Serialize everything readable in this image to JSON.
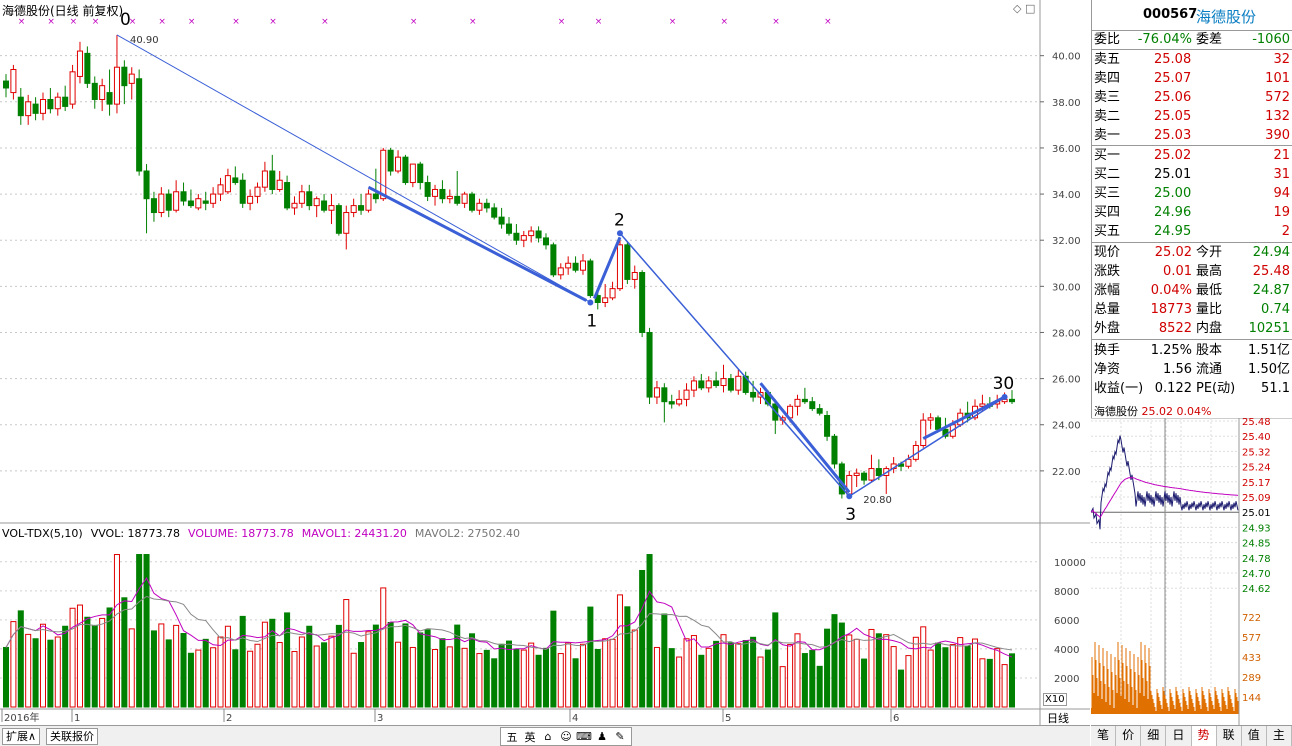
{
  "stock": {
    "code": "000567",
    "name": "海德股份"
  },
  "chart_header": {
    "title": "海德股份(日线 前复权)"
  },
  "price_axis": {
    "labels": [
      "40.00",
      "38.00",
      "36.00",
      "34.00",
      "32.00",
      "30.00",
      "28.00",
      "26.00",
      "24.00",
      "22.00"
    ]
  },
  "time_axis": {
    "labels": [
      "2016年",
      "1",
      "2",
      "3",
      "4",
      "5",
      "6"
    ]
  },
  "annotations": {
    "labels": [
      "0",
      "1",
      "2",
      "3",
      "30"
    ],
    "high_label": "40.90",
    "low_label": "20.80"
  },
  "candles": [
    {
      "o": 38.9,
      "h": 39.2,
      "l": 38.2,
      "c": 38.6
    },
    {
      "o": 38.4,
      "h": 39.6,
      "l": 38.1,
      "c": 39.4
    },
    {
      "o": 38.2,
      "h": 38.6,
      "l": 37.0,
      "c": 37.4
    },
    {
      "o": 37.4,
      "h": 38.3,
      "l": 37.0,
      "c": 38.0
    },
    {
      "o": 37.9,
      "h": 38.2,
      "l": 37.2,
      "c": 37.5
    },
    {
      "o": 37.5,
      "h": 38.4,
      "l": 37.2,
      "c": 38.1
    },
    {
      "o": 38.1,
      "h": 38.6,
      "l": 37.5,
      "c": 37.7
    },
    {
      "o": 37.7,
      "h": 38.4,
      "l": 37.4,
      "c": 38.2
    },
    {
      "o": 38.2,
      "h": 38.7,
      "l": 37.6,
      "c": 37.8
    },
    {
      "o": 37.9,
      "h": 39.6,
      "l": 37.7,
      "c": 39.3
    },
    {
      "o": 39.1,
      "h": 40.6,
      "l": 38.8,
      "c": 40.2
    },
    {
      "o": 40.1,
      "h": 40.4,
      "l": 38.6,
      "c": 38.8
    },
    {
      "o": 38.8,
      "h": 39.1,
      "l": 37.7,
      "c": 38.1
    },
    {
      "o": 38.1,
      "h": 39.0,
      "l": 37.6,
      "c": 38.7
    },
    {
      "o": 38.4,
      "h": 39.4,
      "l": 37.4,
      "c": 37.9
    },
    {
      "o": 37.9,
      "h": 40.9,
      "l": 37.5,
      "c": 39.5
    },
    {
      "o": 39.5,
      "h": 39.8,
      "l": 37.9,
      "c": 38.7
    },
    {
      "o": 38.8,
      "h": 39.5,
      "l": 38.1,
      "c": 39.2
    },
    {
      "o": 39.0,
      "h": 39.4,
      "l": 34.8,
      "c": 35.0
    },
    {
      "o": 35.0,
      "h": 35.3,
      "l": 32.3,
      "c": 33.8
    },
    {
      "o": 33.8,
      "h": 34.1,
      "l": 32.8,
      "c": 33.2
    },
    {
      "o": 33.2,
      "h": 34.3,
      "l": 33.0,
      "c": 34.0
    },
    {
      "o": 34.0,
      "h": 34.2,
      "l": 33.0,
      "c": 33.3
    },
    {
      "o": 33.3,
      "h": 34.6,
      "l": 33.2,
      "c": 34.1
    },
    {
      "o": 34.1,
      "h": 34.5,
      "l": 33.5,
      "c": 33.7
    },
    {
      "o": 33.7,
      "h": 34.2,
      "l": 33.4,
      "c": 33.5
    },
    {
      "o": 33.4,
      "h": 34.0,
      "l": 33.3,
      "c": 33.8
    },
    {
      "o": 33.7,
      "h": 34.1,
      "l": 33.3,
      "c": 33.6
    },
    {
      "o": 33.6,
      "h": 34.3,
      "l": 33.4,
      "c": 34.0
    },
    {
      "o": 34.0,
      "h": 34.7,
      "l": 33.7,
      "c": 34.4
    },
    {
      "o": 34.1,
      "h": 35.1,
      "l": 34.0,
      "c": 34.8
    },
    {
      "o": 34.7,
      "h": 35.2,
      "l": 34.4,
      "c": 34.5
    },
    {
      "o": 34.6,
      "h": 34.9,
      "l": 33.4,
      "c": 33.6
    },
    {
      "o": 33.6,
      "h": 34.2,
      "l": 33.3,
      "c": 33.9
    },
    {
      "o": 33.9,
      "h": 34.5,
      "l": 33.6,
      "c": 34.3
    },
    {
      "o": 34.3,
      "h": 35.4,
      "l": 34.1,
      "c": 35.0
    },
    {
      "o": 35.0,
      "h": 35.7,
      "l": 34.0,
      "c": 34.2
    },
    {
      "o": 34.2,
      "h": 35.0,
      "l": 34.1,
      "c": 34.6
    },
    {
      "o": 34.5,
      "h": 34.8,
      "l": 33.3,
      "c": 33.4
    },
    {
      "o": 33.4,
      "h": 33.9,
      "l": 33.1,
      "c": 33.6
    },
    {
      "o": 33.6,
      "h": 34.4,
      "l": 33.4,
      "c": 34.1
    },
    {
      "o": 34.1,
      "h": 34.4,
      "l": 33.3,
      "c": 33.5
    },
    {
      "o": 33.5,
      "h": 33.9,
      "l": 33.0,
      "c": 33.8
    },
    {
      "o": 33.7,
      "h": 34.0,
      "l": 33.2,
      "c": 33.3
    },
    {
      "o": 33.3,
      "h": 34.0,
      "l": 32.7,
      "c": 33.5
    },
    {
      "o": 33.5,
      "h": 33.6,
      "l": 32.2,
      "c": 32.3
    },
    {
      "o": 32.3,
      "h": 33.5,
      "l": 31.6,
      "c": 33.2
    },
    {
      "o": 33.2,
      "h": 33.8,
      "l": 33.0,
      "c": 33.5
    },
    {
      "o": 33.5,
      "h": 34.0,
      "l": 33.1,
      "c": 33.3
    },
    {
      "o": 33.3,
      "h": 34.2,
      "l": 33.2,
      "c": 34.0
    },
    {
      "o": 34.0,
      "h": 35.1,
      "l": 33.6,
      "c": 33.8
    },
    {
      "o": 33.8,
      "h": 36.0,
      "l": 33.7,
      "c": 35.9
    },
    {
      "o": 35.9,
      "h": 36.0,
      "l": 34.8,
      "c": 35.0
    },
    {
      "o": 35.0,
      "h": 35.9,
      "l": 34.9,
      "c": 35.6
    },
    {
      "o": 35.6,
      "h": 35.7,
      "l": 34.4,
      "c": 34.5
    },
    {
      "o": 34.5,
      "h": 35.3,
      "l": 34.3,
      "c": 35.3
    },
    {
      "o": 35.3,
      "h": 35.4,
      "l": 34.2,
      "c": 34.5
    },
    {
      "o": 34.5,
      "h": 34.8,
      "l": 33.7,
      "c": 33.9
    },
    {
      "o": 33.9,
      "h": 34.4,
      "l": 33.5,
      "c": 34.2
    },
    {
      "o": 34.2,
      "h": 34.6,
      "l": 33.6,
      "c": 33.8
    },
    {
      "o": 33.8,
      "h": 34.2,
      "l": 33.6,
      "c": 33.9
    },
    {
      "o": 33.9,
      "h": 35.0,
      "l": 33.5,
      "c": 33.6
    },
    {
      "o": 33.6,
      "h": 34.1,
      "l": 33.4,
      "c": 34.0
    },
    {
      "o": 34.0,
      "h": 34.1,
      "l": 33.2,
      "c": 33.3
    },
    {
      "o": 33.3,
      "h": 33.8,
      "l": 33.1,
      "c": 33.6
    },
    {
      "o": 33.6,
      "h": 33.8,
      "l": 33.2,
      "c": 33.4
    },
    {
      "o": 33.4,
      "h": 33.6,
      "l": 32.9,
      "c": 33.0
    },
    {
      "o": 33.0,
      "h": 33.4,
      "l": 32.5,
      "c": 32.7
    },
    {
      "o": 32.7,
      "h": 33.0,
      "l": 32.2,
      "c": 32.3
    },
    {
      "o": 32.3,
      "h": 32.7,
      "l": 31.8,
      "c": 32.0
    },
    {
      "o": 32.0,
      "h": 32.4,
      "l": 31.7,
      "c": 32.2
    },
    {
      "o": 32.2,
      "h": 32.6,
      "l": 31.9,
      "c": 32.4
    },
    {
      "o": 32.4,
      "h": 32.6,
      "l": 31.9,
      "c": 32.1
    },
    {
      "o": 32.1,
      "h": 32.3,
      "l": 31.6,
      "c": 31.8
    },
    {
      "o": 31.8,
      "h": 31.9,
      "l": 30.4,
      "c": 30.5
    },
    {
      "o": 30.5,
      "h": 31.0,
      "l": 30.3,
      "c": 30.8
    },
    {
      "o": 30.8,
      "h": 31.3,
      "l": 30.5,
      "c": 31.0
    },
    {
      "o": 31.0,
      "h": 31.3,
      "l": 30.6,
      "c": 30.7
    },
    {
      "o": 30.7,
      "h": 31.4,
      "l": 30.5,
      "c": 31.1
    },
    {
      "o": 31.1,
      "h": 31.2,
      "l": 29.5,
      "c": 29.6
    },
    {
      "o": 29.6,
      "h": 29.9,
      "l": 29.0,
      "c": 29.3
    },
    {
      "o": 29.3,
      "h": 30.1,
      "l": 29.1,
      "c": 29.5
    },
    {
      "o": 29.5,
      "h": 30.2,
      "l": 29.4,
      "c": 29.9
    },
    {
      "o": 29.9,
      "h": 32.1,
      "l": 29.8,
      "c": 31.8
    },
    {
      "o": 31.8,
      "h": 31.9,
      "l": 30.1,
      "c": 30.3
    },
    {
      "o": 30.3,
      "h": 30.9,
      "l": 29.9,
      "c": 30.6
    },
    {
      "o": 30.6,
      "h": 30.7,
      "l": 27.8,
      "c": 28.0
    },
    {
      "o": 28.0,
      "h": 28.2,
      "l": 24.9,
      "c": 25.2
    },
    {
      "o": 25.2,
      "h": 25.9,
      "l": 24.9,
      "c": 25.6
    },
    {
      "o": 25.6,
      "h": 25.8,
      "l": 24.1,
      "c": 25.0
    },
    {
      "o": 25.0,
      "h": 25.3,
      "l": 24.7,
      "c": 24.9
    },
    {
      "o": 24.9,
      "h": 25.5,
      "l": 24.8,
      "c": 25.1
    },
    {
      "o": 25.1,
      "h": 25.8,
      "l": 24.8,
      "c": 25.5
    },
    {
      "o": 25.5,
      "h": 26.1,
      "l": 25.2,
      "c": 25.9
    },
    {
      "o": 25.9,
      "h": 26.2,
      "l": 25.5,
      "c": 25.6
    },
    {
      "o": 25.6,
      "h": 26.1,
      "l": 25.4,
      "c": 25.9
    },
    {
      "o": 25.9,
      "h": 26.3,
      "l": 25.6,
      "c": 25.7
    },
    {
      "o": 25.7,
      "h": 26.6,
      "l": 25.4,
      "c": 26.0
    },
    {
      "o": 26.0,
      "h": 26.2,
      "l": 25.4,
      "c": 25.5
    },
    {
      "o": 25.5,
      "h": 26.4,
      "l": 25.3,
      "c": 26.1
    },
    {
      "o": 26.1,
      "h": 26.3,
      "l": 25.3,
      "c": 25.4
    },
    {
      "o": 25.4,
      "h": 25.9,
      "l": 25.0,
      "c": 25.2
    },
    {
      "o": 25.2,
      "h": 25.6,
      "l": 24.9,
      "c": 25.4
    },
    {
      "o": 25.4,
      "h": 25.5,
      "l": 24.8,
      "c": 24.9
    },
    {
      "o": 24.9,
      "h": 25.1,
      "l": 23.6,
      "c": 24.2
    },
    {
      "o": 24.2,
      "h": 24.4,
      "l": 24.0,
      "c": 24.3
    },
    {
      "o": 24.3,
      "h": 24.9,
      "l": 24.1,
      "c": 24.8
    },
    {
      "o": 24.8,
      "h": 25.3,
      "l": 24.4,
      "c": 25.1
    },
    {
      "o": 25.1,
      "h": 25.6,
      "l": 24.9,
      "c": 25.0
    },
    {
      "o": 25.0,
      "h": 25.2,
      "l": 24.6,
      "c": 24.7
    },
    {
      "o": 24.7,
      "h": 24.9,
      "l": 24.4,
      "c": 24.5
    },
    {
      "o": 24.4,
      "h": 24.6,
      "l": 23.3,
      "c": 23.5
    },
    {
      "o": 23.5,
      "h": 23.6,
      "l": 22.1,
      "c": 22.3
    },
    {
      "o": 22.3,
      "h": 22.4,
      "l": 20.8,
      "c": 21.0
    },
    {
      "o": 21.0,
      "h": 22.0,
      "l": 20.9,
      "c": 21.8
    },
    {
      "o": 21.8,
      "h": 22.1,
      "l": 21.3,
      "c": 21.9
    },
    {
      "o": 21.9,
      "h": 22.0,
      "l": 21.4,
      "c": 21.6
    },
    {
      "o": 21.6,
      "h": 22.7,
      "l": 21.5,
      "c": 22.1
    },
    {
      "o": 22.1,
      "h": 22.5,
      "l": 21.6,
      "c": 21.8
    },
    {
      "o": 21.8,
      "h": 22.2,
      "l": 21.0,
      "c": 22.1
    },
    {
      "o": 22.1,
      "h": 22.6,
      "l": 21.9,
      "c": 22.3
    },
    {
      "o": 22.3,
      "h": 22.4,
      "l": 22.0,
      "c": 22.2
    },
    {
      "o": 22.2,
      "h": 22.7,
      "l": 22.1,
      "c": 22.5
    },
    {
      "o": 22.5,
      "h": 23.3,
      "l": 22.4,
      "c": 23.1
    },
    {
      "o": 23.1,
      "h": 24.5,
      "l": 23.0,
      "c": 24.2
    },
    {
      "o": 24.2,
      "h": 24.5,
      "l": 23.8,
      "c": 24.3
    },
    {
      "o": 24.3,
      "h": 24.4,
      "l": 23.7,
      "c": 23.8
    },
    {
      "o": 23.8,
      "h": 24.3,
      "l": 23.4,
      "c": 23.5
    },
    {
      "o": 23.5,
      "h": 24.2,
      "l": 23.4,
      "c": 24.0
    },
    {
      "o": 24.0,
      "h": 24.7,
      "l": 23.9,
      "c": 24.5
    },
    {
      "o": 24.5,
      "h": 25.0,
      "l": 24.1,
      "c": 24.3
    },
    {
      "o": 24.3,
      "h": 25.1,
      "l": 24.2,
      "c": 24.8
    },
    {
      "o": 24.8,
      "h": 25.3,
      "l": 24.6,
      "c": 24.9
    },
    {
      "o": 24.9,
      "h": 25.2,
      "l": 24.7,
      "c": 24.8
    },
    {
      "o": 24.9,
      "h": 25.3,
      "l": 24.7,
      "c": 25.0
    },
    {
      "o": 25.0,
      "h": 25.4,
      "l": 24.9,
      "c": 25.1
    },
    {
      "o": 25.1,
      "h": 25.5,
      "l": 24.9,
      "c": 25.0
    }
  ],
  "volume_panel": {
    "label": "VOL-TDX(5,10)",
    "vvol": "VVOL: 18773.78",
    "volume": "VOLUME: 18773.78",
    "mavol1": "MAVOL1: 24431.20",
    "mavol2": "MAVOL2: 27502.40",
    "axis_labels": [
      "10000",
      "8000",
      "6000",
      "4000",
      "2000"
    ],
    "x10": "X10"
  },
  "colors": {
    "up": "#e00000",
    "down": "#008000",
    "trend": "#3a5fd6",
    "ma1": "#c000c0",
    "ma2": "#888888",
    "avg_line": "#c000c0"
  },
  "bottom_tabs": {
    "expand": "扩展∧",
    "related": "关联报价"
  },
  "ime": {
    "items": [
      "五",
      "英",
      "⌂",
      "☺",
      "⌨",
      "♟",
      "✎"
    ]
  },
  "period_label": "日线",
  "quote": {
    "weibi": {
      "label": "委比",
      "value": "-76.04%"
    },
    "weicha": {
      "label": "委差",
      "value": "-1060"
    },
    "sell": [
      {
        "label": "卖五",
        "price": "25.08",
        "vol": "32"
      },
      {
        "label": "卖四",
        "price": "25.07",
        "vol": "101"
      },
      {
        "label": "卖三",
        "price": "25.06",
        "vol": "572"
      },
      {
        "label": "卖二",
        "price": "25.05",
        "vol": "132"
      },
      {
        "label": "卖一",
        "price": "25.03",
        "vol": "390"
      }
    ],
    "buy": [
      {
        "label": "买一",
        "price": "25.02",
        "vol": "21"
      },
      {
        "label": "买二",
        "price": "25.01",
        "vol": "31"
      },
      {
        "label": "买三",
        "price": "25.00",
        "vol": "94"
      },
      {
        "label": "买四",
        "price": "24.96",
        "vol": "19"
      },
      {
        "label": "买五",
        "price": "24.95",
        "vol": "2"
      }
    ],
    "stats": [
      {
        "l1": "现价",
        "v1": "25.02",
        "l2": "今开",
        "v2": "24.94"
      },
      {
        "l1": "涨跌",
        "v1": "0.01",
        "l2": "最高",
        "v2": "25.48"
      },
      {
        "l1": "涨幅",
        "v1": "0.04%",
        "l2": "最低",
        "v2": "24.87"
      },
      {
        "l1": "总量",
        "v1": "18773",
        "l2": "量比",
        "v2": "0.74"
      },
      {
        "l1": "外盘",
        "v1": "8522",
        "l2": "内盘",
        "v2": "10251"
      }
    ],
    "fund": [
      {
        "l1": "换手",
        "v1": "1.25%",
        "l2": "股本",
        "v2": "1.51亿"
      },
      {
        "l1": "净资",
        "v1": "1.56",
        "l2": "流通",
        "v2": "1.50亿"
      },
      {
        "l1": "收益(一)",
        "v1": "0.122",
        "l2": "PE(动)",
        "v2": "51.1"
      }
    ]
  },
  "mini": {
    "name": "海德股份",
    "price": "25.02",
    "pct": "0.04%",
    "price_labels": [
      "25.48",
      "25.40",
      "25.32",
      "25.24",
      "25.17",
      "25.09",
      "25.01",
      "24.93",
      "24.85",
      "24.78",
      "24.70",
      "24.62"
    ],
    "vol_labels": [
      "722",
      "577",
      "433",
      "289",
      "144"
    ],
    "tabs": [
      "笔",
      "价",
      "细",
      "日",
      "势",
      "联",
      "值",
      "主"
    ]
  }
}
